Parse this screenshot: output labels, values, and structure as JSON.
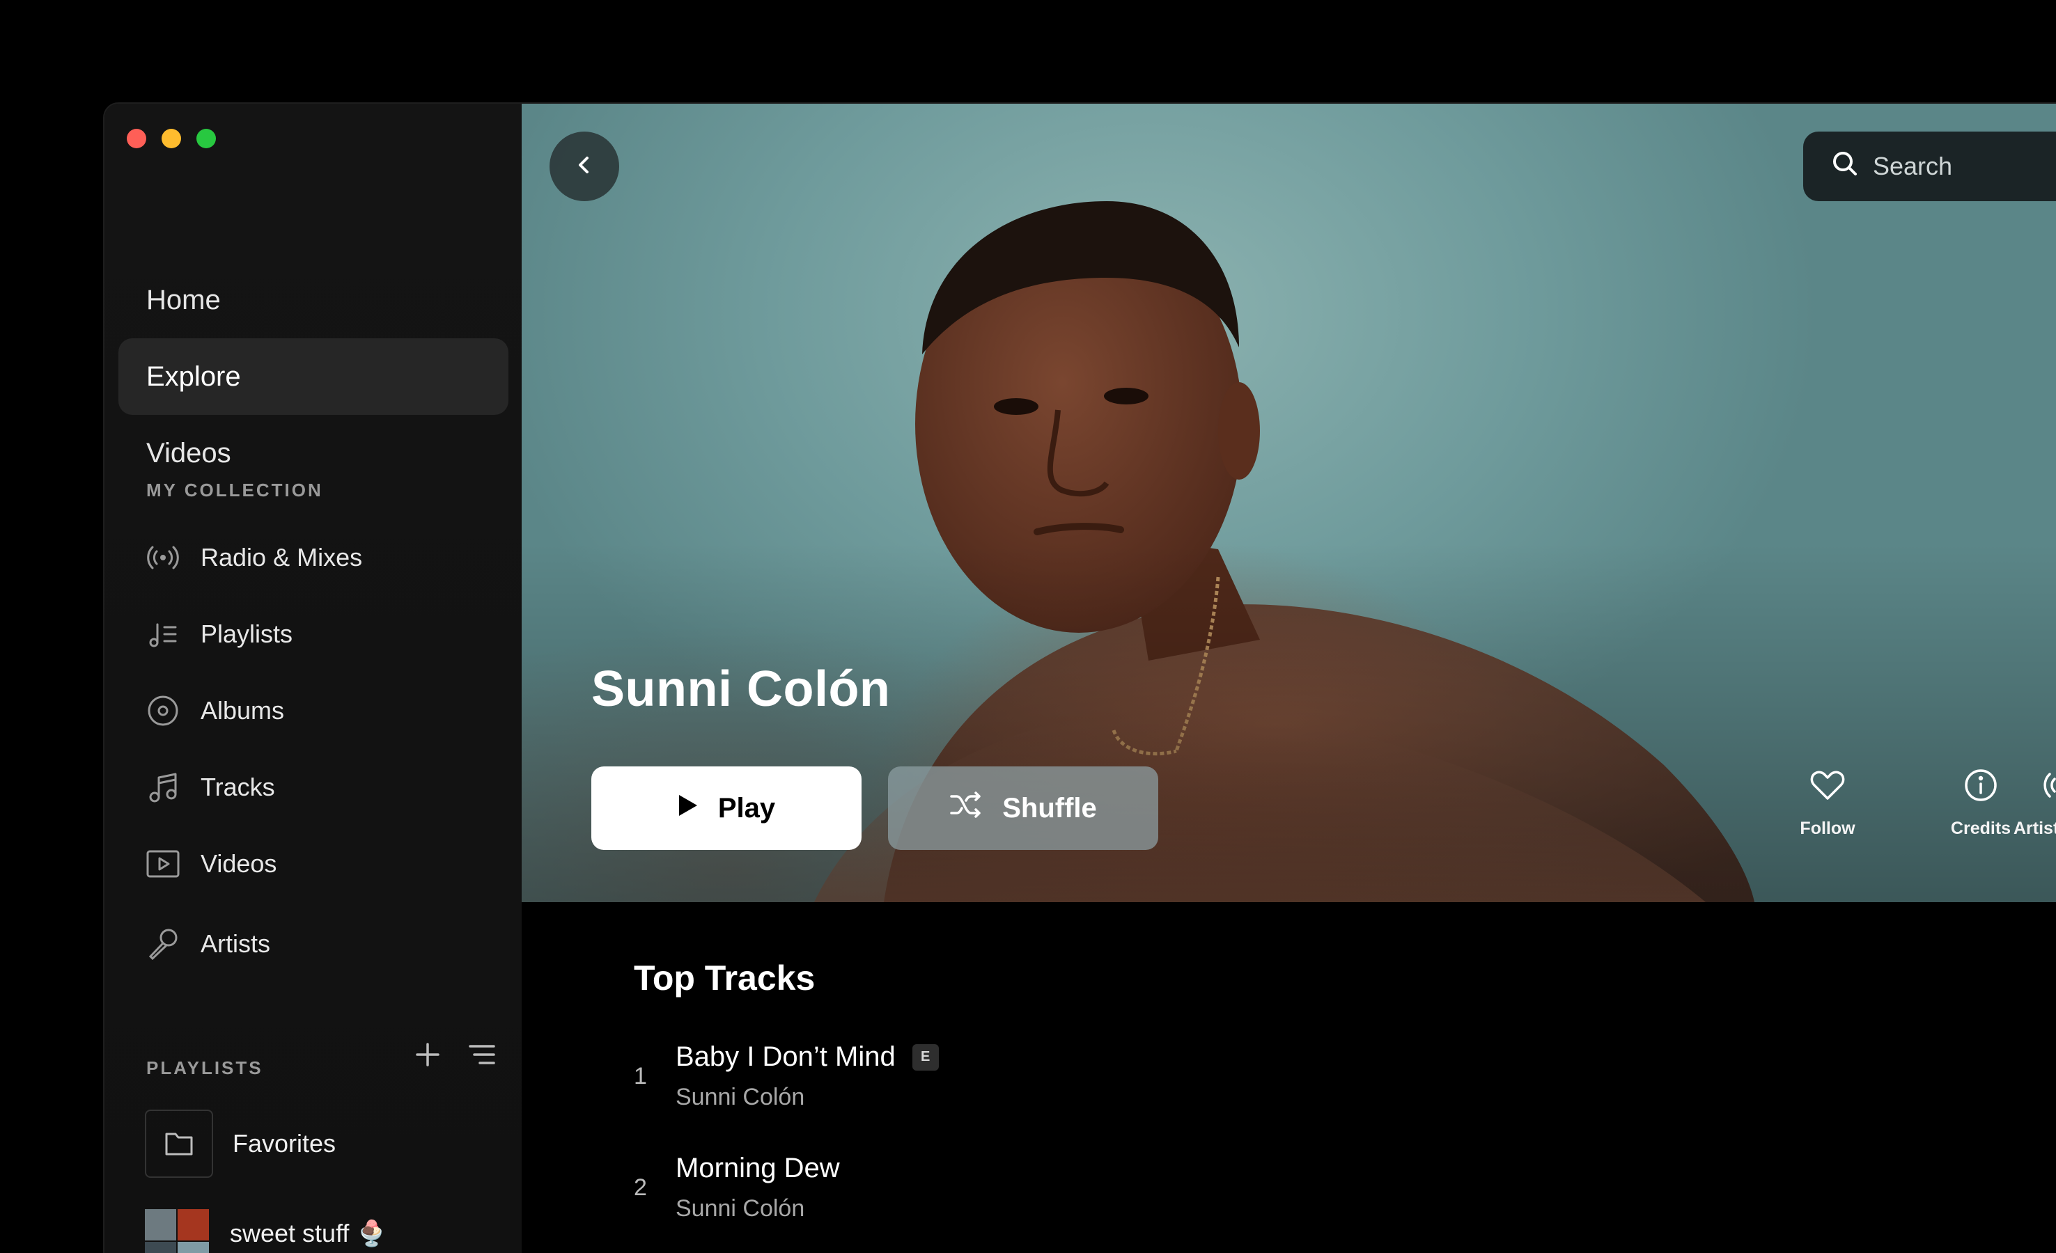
{
  "nav": {
    "items": [
      {
        "label": "Home"
      },
      {
        "label": "Explore",
        "active": true
      },
      {
        "label": "Videos"
      }
    ]
  },
  "collection": {
    "header": "MY COLLECTION",
    "items": [
      {
        "label": "Radio & Mixes",
        "icon": "radio-icon"
      },
      {
        "label": "Playlists",
        "icon": "playlist-icon"
      },
      {
        "label": "Albums",
        "icon": "album-icon"
      },
      {
        "label": "Tracks",
        "icon": "music-note-icon"
      },
      {
        "label": "Videos",
        "icon": "video-icon"
      },
      {
        "label": "Artists",
        "icon": "microphone-icon"
      }
    ]
  },
  "playlists": {
    "header": "PLAYLISTS",
    "items": [
      {
        "label": "Favorites",
        "icon": "folder-icon"
      },
      {
        "label": "sweet stuff 🍨"
      }
    ]
  },
  "hero": {
    "artist_name": "Sunni Colón",
    "search_placeholder": "Search",
    "play_label": "Play",
    "shuffle_label": "Shuffle",
    "actions": [
      {
        "label": "Follow",
        "icon": "heart-icon"
      },
      {
        "label": "Credits",
        "icon": "info-icon"
      },
      {
        "label": "Artist Rad",
        "icon": "radio-icon"
      }
    ]
  },
  "top_tracks": {
    "title": "Top Tracks",
    "tracks": [
      {
        "num": "1",
        "title": "Baby I Don’t Mind",
        "artist": "Sunni Colón",
        "explicit": "E"
      },
      {
        "num": "2",
        "title": "Morning Dew",
        "artist": "Sunni Colón"
      }
    ]
  },
  "colors": {
    "sidebar_bg": "#141414",
    "active_nav_bg": "#262626",
    "hero_teal": "#6f9b9c",
    "traffic_red": "#fe5f57",
    "traffic_yellow": "#febc2e",
    "traffic_green": "#28c840"
  }
}
